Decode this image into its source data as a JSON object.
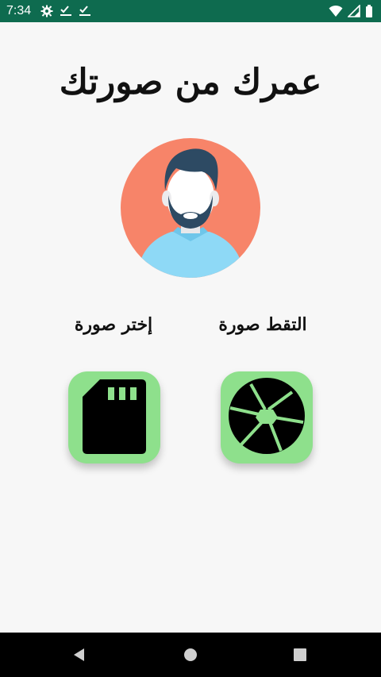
{
  "status_bar": {
    "time": "7:34",
    "left_icons": [
      "gear-icon",
      "check-icon",
      "check-icon"
    ],
    "right_icons": [
      "wifi-icon",
      "signal-icon",
      "battery-icon"
    ],
    "background": "#0e6b4f"
  },
  "main": {
    "title": "عمرك من صورتك",
    "avatar": "avatar-illustration",
    "capture": {
      "label": "التقط صورة",
      "icon": "camera-shutter-icon"
    },
    "choose": {
      "label": "إختر صورة",
      "icon": "sd-card-icon"
    },
    "button_color": "#8ee08c"
  },
  "nav_bar": {
    "buttons": [
      "back-icon",
      "home-icon",
      "recents-icon"
    ]
  }
}
